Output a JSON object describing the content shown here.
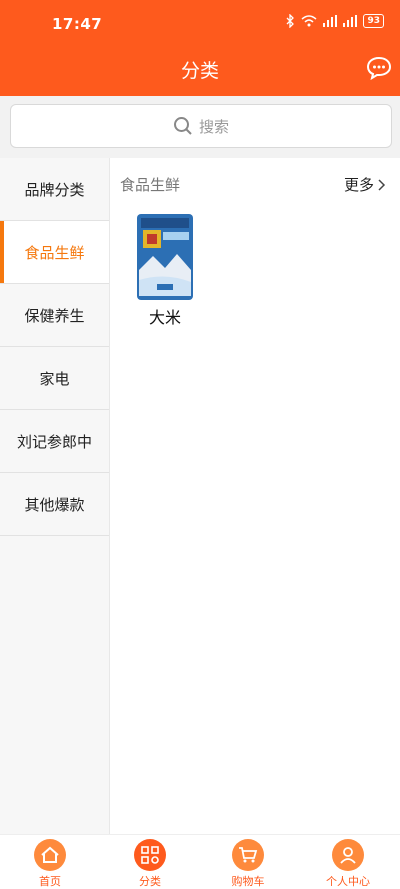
{
  "status": {
    "time": "17:47",
    "battery": "93"
  },
  "header": {
    "title": "分类"
  },
  "search": {
    "placeholder": "搜索"
  },
  "sidebar": {
    "items": [
      {
        "label": "品牌分类",
        "active": false
      },
      {
        "label": "食品生鲜",
        "active": true
      },
      {
        "label": "保健养生",
        "active": false
      },
      {
        "label": "家电",
        "active": false
      },
      {
        "label": "刘记参郎中",
        "active": false
      },
      {
        "label": "其他爆款",
        "active": false
      }
    ]
  },
  "section": {
    "title": "食品生鲜",
    "more": "更多"
  },
  "products": [
    {
      "name": "大米"
    }
  ],
  "tabbar": {
    "items": [
      {
        "label": "首页"
      },
      {
        "label": "分类"
      },
      {
        "label": "购物车"
      },
      {
        "label": "个人中心"
      }
    ]
  },
  "colors": {
    "primary": "#fe5a1d",
    "accent": "#f5780e"
  }
}
